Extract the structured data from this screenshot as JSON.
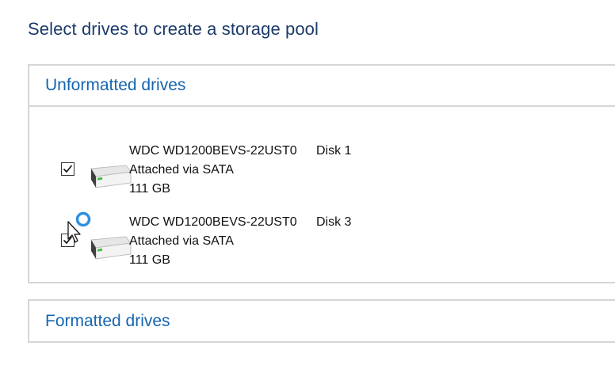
{
  "page": {
    "title": "Select drives to create a storage pool"
  },
  "unformatted": {
    "header": "Unformatted drives",
    "drives": [
      {
        "name": "WDC WD1200BEVS-22UST0",
        "connection": "Attached via SATA",
        "size": "111 GB",
        "disk": "Disk 1",
        "checked": true
      },
      {
        "name": "WDC WD1200BEVS-22UST0",
        "connection": "Attached via SATA",
        "size": "111 GB",
        "disk": "Disk 3",
        "checked": true
      }
    ]
  },
  "formatted": {
    "header": "Formatted drives"
  },
  "colors": {
    "title": "#1c3a6b",
    "section_header": "#1565b0",
    "border": "#d6d6d6",
    "busy_cursor_ring": "#2e8fe0"
  },
  "icons": {
    "drive": "hard-drive-icon",
    "check": "checkmark-icon",
    "cursor": "busy-pointer-cursor-icon"
  }
}
